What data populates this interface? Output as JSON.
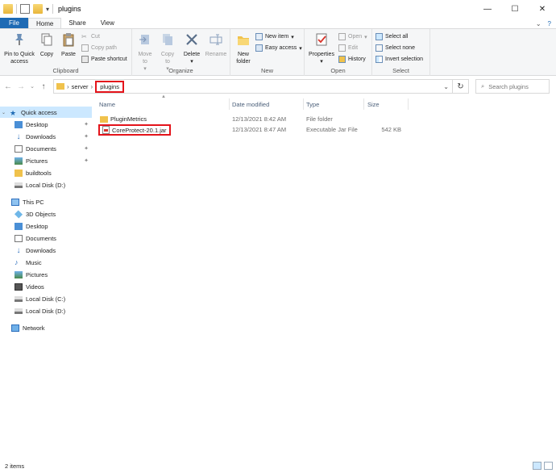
{
  "window": {
    "title": "plugins",
    "minimize": "—",
    "maximize": "☐",
    "close": "✕"
  },
  "ribbon_tabs": [
    "File",
    "Home",
    "Share",
    "View"
  ],
  "ribbon": {
    "clipboard": {
      "label": "Clipboard",
      "pin": "Pin to Quick access",
      "pin_line1": "Pin to Quick",
      "pin_line2": "access",
      "copy": "Copy",
      "paste": "Paste",
      "cut": "Cut",
      "copy_path": "Copy path",
      "paste_shortcut": "Paste shortcut"
    },
    "organize": {
      "label": "Organize",
      "move_to": "Move to",
      "copy_to": "Copy to",
      "delete": "Delete",
      "rename": "Rename"
    },
    "new": {
      "label": "New",
      "new_folder_line1": "New",
      "new_folder_line2": "folder",
      "new_item": "New item",
      "easy_access": "Easy access"
    },
    "open": {
      "label": "Open",
      "properties": "Properties",
      "open": "Open",
      "edit": "Edit",
      "history": "History"
    },
    "select": {
      "label": "Select",
      "select_all": "Select all",
      "select_none": "Select none",
      "invert_selection": "Invert selection"
    }
  },
  "address": {
    "crumbs": [
      "server",
      "plugins"
    ],
    "search_placeholder": "Search plugins"
  },
  "nav_pane": {
    "quick_access": "Quick access",
    "quick_items": [
      {
        "label": "Desktop",
        "icon": "desktop-icon",
        "pinned": true
      },
      {
        "label": "Downloads",
        "icon": "download-icon",
        "pinned": true
      },
      {
        "label": "Documents",
        "icon": "documents-icon",
        "pinned": true
      },
      {
        "label": "Pictures",
        "icon": "pictures-icon",
        "pinned": true
      },
      {
        "label": "buildtools",
        "icon": "folder-icon",
        "pinned": false
      },
      {
        "label": "Local Disk (D:)",
        "icon": "drive-icon",
        "pinned": false
      }
    ],
    "this_pc": "This PC",
    "pc_items": [
      {
        "label": "3D Objects",
        "icon": "3d-objects-icon"
      },
      {
        "label": "Desktop",
        "icon": "desktop-icon"
      },
      {
        "label": "Documents",
        "icon": "documents-icon"
      },
      {
        "label": "Downloads",
        "icon": "download-icon"
      },
      {
        "label": "Music",
        "icon": "music-icon"
      },
      {
        "label": "Pictures",
        "icon": "pictures-icon"
      },
      {
        "label": "Videos",
        "icon": "videos-icon"
      },
      {
        "label": "Local Disk (C:)",
        "icon": "drive-icon"
      },
      {
        "label": "Local Disk (D:)",
        "icon": "drive-icon"
      }
    ],
    "network": "Network"
  },
  "file_list": {
    "columns": [
      "Name",
      "Date modified",
      "Type",
      "Size"
    ],
    "rows": [
      {
        "name": "PluginMetrics",
        "date": "12/13/2021 8:42 AM",
        "type": "File folder",
        "size": ""
      },
      {
        "name": "CoreProtect-20.1.jar",
        "date": "12/13/2021 8:47 AM",
        "type": "Executable Jar File",
        "size": "542 KB"
      }
    ]
  },
  "status": {
    "item_count": "2 items"
  },
  "colors": {
    "file_tab": "#1e6ab4",
    "highlight_box": "#e4141b",
    "selection": "#cce8ff"
  }
}
